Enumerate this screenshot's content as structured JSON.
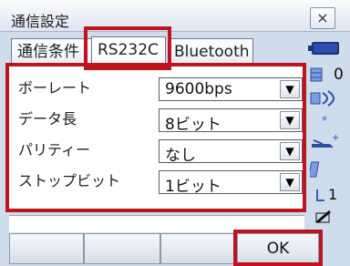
{
  "window": {
    "title": "通信設定",
    "close_glyph": "×"
  },
  "tabs": [
    {
      "label": "通信条件",
      "selected": false
    },
    {
      "label": "RS232C",
      "selected": true
    },
    {
      "label": "Bluetooth",
      "selected": false
    }
  ],
  "form": {
    "rows": [
      {
        "label": "ボーレート",
        "value": "9600bps"
      },
      {
        "label": "データ長",
        "value": "8ビット"
      },
      {
        "label": "パリティー",
        "value": "なし"
      },
      {
        "label": "ストップビット",
        "value": "1ビット"
      }
    ],
    "dropdown_glyph": "▼"
  },
  "side_icons": {
    "battery": "battery-icon",
    "zero_value": "0",
    "laser_icon": "laser-icon",
    "dot_icon": "dot-icon",
    "prism_icon": "prism-icon",
    "tilt_icon": "tilt-icon",
    "one_value": "1",
    "pen_icon": "pen-icon"
  },
  "softkeys": [
    {
      "label": ""
    },
    {
      "label": ""
    },
    {
      "label": ""
    },
    {
      "label": ""
    },
    {
      "label": "OK"
    }
  ],
  "colors": {
    "highlight": "#c0141c",
    "background": "#cfdcec"
  }
}
